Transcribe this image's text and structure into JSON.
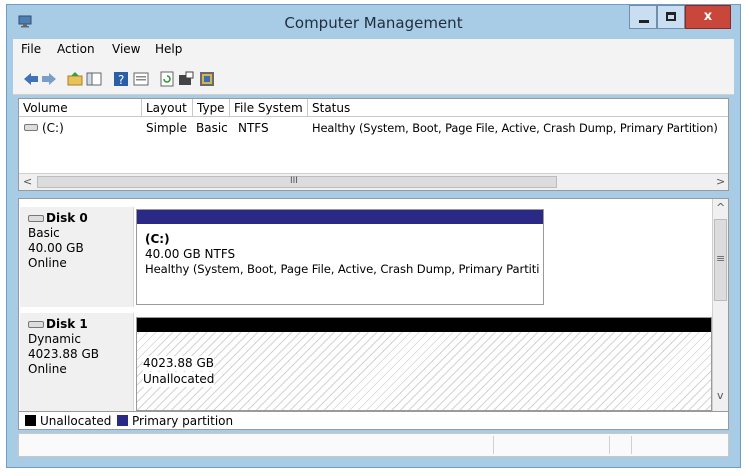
{
  "window": {
    "title": "Computer Management",
    "close_glyph": "x",
    "colors": {
      "frame": "#a8cbe6",
      "close": "#c8463a",
      "primary_partition": "#2a2a86",
      "unallocated": "#000000"
    }
  },
  "menubar": {
    "items": [
      "File",
      "Action",
      "View",
      "Help"
    ]
  },
  "toolbar": {
    "icons": [
      "back-arrow-icon",
      "forward-arrow-icon",
      "up-folder-icon",
      "show-hide-tree-icon",
      "help-icon",
      "properties-icon",
      "refresh-icon",
      "export-list-icon",
      "settings-icon"
    ]
  },
  "volume_table": {
    "columns": [
      "Volume",
      "Layout",
      "Type",
      "File System",
      "Status"
    ],
    "rows": [
      {
        "volume": "(C:)",
        "layout": "Simple",
        "type": "Basic",
        "file_system": "NTFS",
        "status": "Healthy (System, Boot, Page File, Active, Crash Dump, Primary Partition)"
      }
    ],
    "scroll_thumb_glyph": "III"
  },
  "disks": [
    {
      "name": "Disk 0",
      "type": "Basic",
      "size": "40.00 GB",
      "state": "Online",
      "partition": {
        "label": "(C:)",
        "size_fs": "40.00 GB NTFS",
        "status": "Healthy (System, Boot, Page File, Active, Crash Dump, Primary Partiti"
      }
    },
    {
      "name": "Disk 1",
      "type": "Dynamic",
      "size": "4023.88 GB",
      "state": "Online",
      "partition": {
        "size": "4023.88 GB",
        "status": "Unallocated"
      }
    }
  ],
  "legend": {
    "unallocated": "Unallocated",
    "primary": "Primary partition"
  },
  "scroll_glyphs": {
    "left": "<",
    "right": ">",
    "up": "^",
    "down": "v",
    "grip": "≡"
  }
}
